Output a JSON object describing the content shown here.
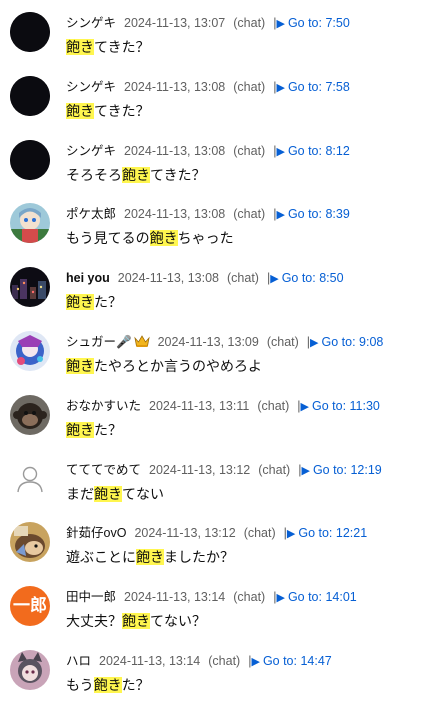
{
  "comments": [
    {
      "author": "シンゲキ",
      "date": "2024-11-13, 13:07",
      "kind": "(chat)",
      "goto": "Go to: 7:50",
      "before": "",
      "highlight": "飽き",
      "after": "てきた？",
      "avatar": "dark"
    },
    {
      "author": "シンゲキ",
      "date": "2024-11-13, 13:08",
      "kind": "(chat)",
      "goto": "Go to: 7:58",
      "before": "",
      "highlight": "飽き",
      "after": "てきた？",
      "avatar": "dark"
    },
    {
      "author": "シンゲキ",
      "date": "2024-11-13, 13:08",
      "kind": "(chat)",
      "goto": "Go to: 8:12",
      "before": "そろそろ",
      "highlight": "飽き",
      "after": "てきた？",
      "avatar": "dark"
    },
    {
      "author": "ポケ太郎",
      "date": "2024-11-13, 13:08",
      "kind": "(chat)",
      "goto": "Go to: 8:39",
      "before": "もう見てるの",
      "highlight": "飽き",
      "after": "ちゃった",
      "avatar": "anime-girl"
    },
    {
      "author": "hei you",
      "date": "2024-11-13, 13:08",
      "kind": "(chat)",
      "goto": "Go to: 8:50",
      "before": "",
      "highlight": "飽き",
      "after": "た？",
      "avatar": "night-city"
    },
    {
      "author": "シュガー🎤",
      "date": "2024-11-13, 13:09",
      "kind": "(chat)",
      "goto": "Go to: 9:08",
      "before": "",
      "highlight": "飽き",
      "after": "たやろとか言うのやめろよ",
      "avatar": "blue-anime",
      "badge": "crown-icon"
    },
    {
      "author": "おなかすいた",
      "date": "2024-11-13, 13:11",
      "kind": "(chat)",
      "goto": "Go to: 11:30",
      "before": "",
      "highlight": "飽き",
      "after": "た？",
      "avatar": "monkey"
    },
    {
      "author": "てててでめて",
      "date": "2024-11-13, 13:12",
      "kind": "(chat)",
      "goto": "Go to: 12:19",
      "before": "まだ",
      "highlight": "飽き",
      "after": "てない",
      "avatar": "default-user"
    },
    {
      "author": "針茹仔ovO",
      "date": "2024-11-13, 13:12",
      "kind": "(chat)",
      "goto": "Go to: 12:21",
      "before": "遊ぶことに",
      "highlight": "飽き",
      "after": "ましたか？",
      "avatar": "hedgehog"
    },
    {
      "author": "田中一郎",
      "date": "2024-11-13, 13:14",
      "kind": "(chat)",
      "goto": "Go to: 14:01",
      "before": "大丈夫？",
      "highlight": "飽き",
      "after": "てない？",
      "avatar": "letter",
      "avatar_text": "一郎"
    },
    {
      "author": "ハロ",
      "date": "2024-11-13, 13:14",
      "kind": "(chat)",
      "goto": "Go to: 14:47",
      "before": "もう",
      "highlight": "飽き",
      "after": "た？",
      "avatar": "cat-girl"
    }
  ],
  "separator": "|",
  "colors": {
    "link": "#065fd4",
    "meta": "#606060",
    "highlight": "#fff64f",
    "letter_avatar": "#f26b1d"
  }
}
